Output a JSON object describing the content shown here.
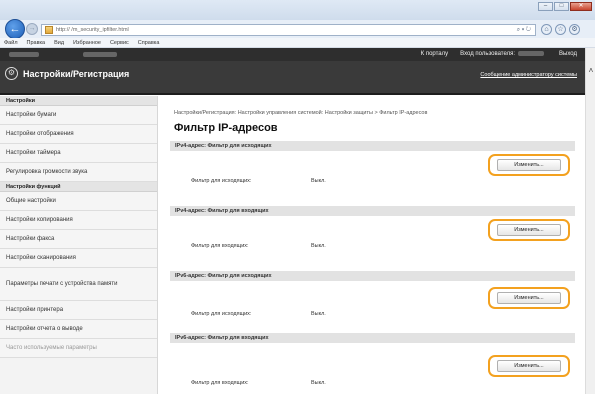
{
  "browser": {
    "url": "http://              /m_security_ipfilter.html",
    "menu": [
      "Файл",
      "Правка",
      "Вид",
      "Избранное",
      "Сервис",
      "Справка"
    ],
    "search_label": "⌕ ▾ ↻",
    "window_controls": [
      "–",
      "□",
      "✕"
    ]
  },
  "header": {
    "site_title": "Настройки/Регистрация",
    "to_portal": "К порталу",
    "login_user_label": "Вход пользователя:",
    "logout": "Выход",
    "admin_message": "Сообщение администратору системы"
  },
  "sidebar": {
    "group1_title": "Настройки",
    "group1_items": [
      "Настройки бумаги",
      "Настройки отображения",
      "Настройки таймера",
      "Регулировка громкости звука"
    ],
    "group2_title": "Настройки функций",
    "group2_items": [
      "Общие настройки",
      "Настройки копирования",
      "Настройки факса",
      "Настройки сканирования",
      "Параметры печати с устройства памяти",
      "Настройки принтера",
      "Настройки отчета о выводе",
      "Часто используемые параметры"
    ]
  },
  "main": {
    "breadcrumb": "Настройки/Регистрация: Настройки управления системой: Настройки защиты > Фильтр IP-адресов",
    "page_title": "Фильтр IP-адресов",
    "sections": [
      {
        "title": "IPv4-адрес: Фильтр для исходящих",
        "field_label": "Фильтр для исходящих:",
        "value": "Выкл.",
        "button_label": "Изменить..."
      },
      {
        "title": "IPv4-адрес: Фильтр для входящих",
        "field_label": "Фильтр для входящих:",
        "value": "Выкл.",
        "button_label": "Изменить..."
      },
      {
        "title": "IPv6-адрес: Фильтр для исходящих",
        "field_label": "Фильтр для исходящих:",
        "value": "Выкл.",
        "button_label": "Изменить..."
      },
      {
        "title": "IPv6-адрес: Фильтр для входящих",
        "field_label": "Фильтр для входящих:",
        "value": "Выкл.",
        "button_label": "Изменить..."
      }
    ]
  },
  "colors": {
    "header_bg": "#3a3a3a",
    "button_highlight": "#f3a11f",
    "section_head_bg": "#e2e2e2"
  }
}
